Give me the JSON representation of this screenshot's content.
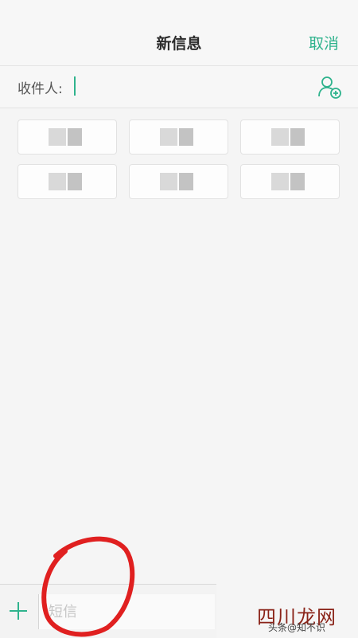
{
  "header": {
    "title": "新信息",
    "cancel_label": "取消"
  },
  "recipient": {
    "label": "收件人:"
  },
  "contacts": {
    "chips": [
      {
        "state": "blurred"
      },
      {
        "state": "blurred"
      },
      {
        "state": "blurred"
      },
      {
        "state": "blurred"
      },
      {
        "state": "blurred"
      },
      {
        "state": "blurred"
      }
    ]
  },
  "composer": {
    "placeholder": "短信"
  },
  "watermark": {
    "logo": "四川龙网",
    "sub": "头条@知不识"
  },
  "colors": {
    "accent": "#2fb38d",
    "annotation": "#e02020"
  },
  "icons": {
    "add_contact": "person-plus-icon",
    "add_attachment": "plus-icon"
  }
}
